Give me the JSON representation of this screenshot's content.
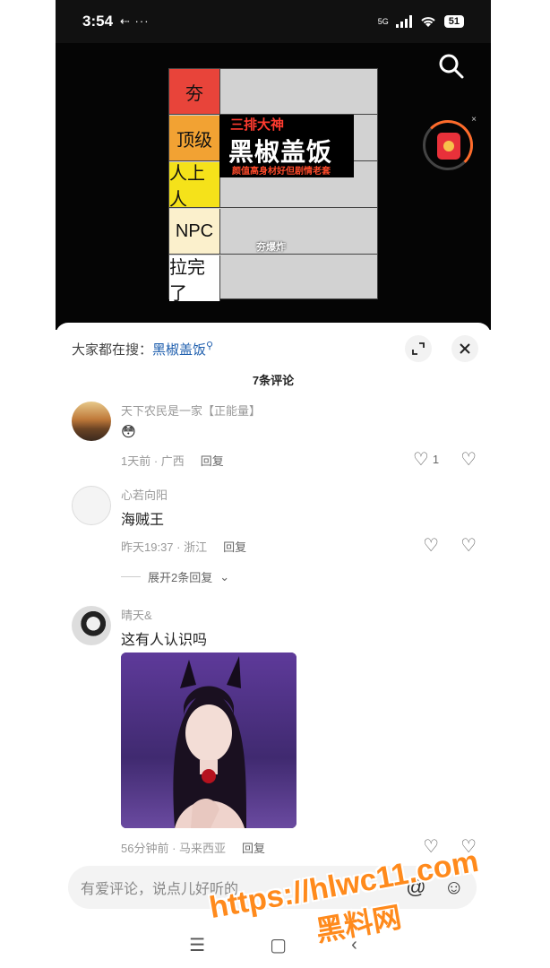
{
  "status_bar": {
    "time": "3:54",
    "left_icons": "⇠ ···",
    "network": "5G",
    "battery": "51"
  },
  "video": {
    "tier_labels": [
      "夯",
      "顶级",
      "人上人",
      "NPC",
      "拉完了"
    ],
    "tier_colors": [
      "#e8443a",
      "#f2a233",
      "#f5e21a",
      "#fbf0cc",
      "#ffffff"
    ],
    "overlay_top": "三排大神",
    "overlay_main": "黑椒盖饭",
    "overlay_sub": "颜值高身材好但剧情老套",
    "small_caption": "夯爆炸"
  },
  "sheet": {
    "trend_prefix": "大家都在搜：",
    "trend_query": "黑椒盖饭",
    "comment_count": "7条评论"
  },
  "comments": [
    {
      "name": "天下农民是一家【正能量】",
      "text": "😳",
      "time": "1天前 · 广西",
      "reply": "回复",
      "likes": "1"
    },
    {
      "name": "心若向阳",
      "text": "海贼王",
      "time": "昨天19:37 · 浙江",
      "reply": "回复",
      "expand": "展开2条回复"
    },
    {
      "name": "晴天&",
      "text": "这有人认识吗",
      "time": "56分钟前 · 马来西亚",
      "reply": "回复"
    }
  ],
  "input": {
    "placeholder": "有爱评论，说点儿好听的"
  },
  "watermark": {
    "url": "https://hlwc11.com",
    "name": "黑料网"
  }
}
